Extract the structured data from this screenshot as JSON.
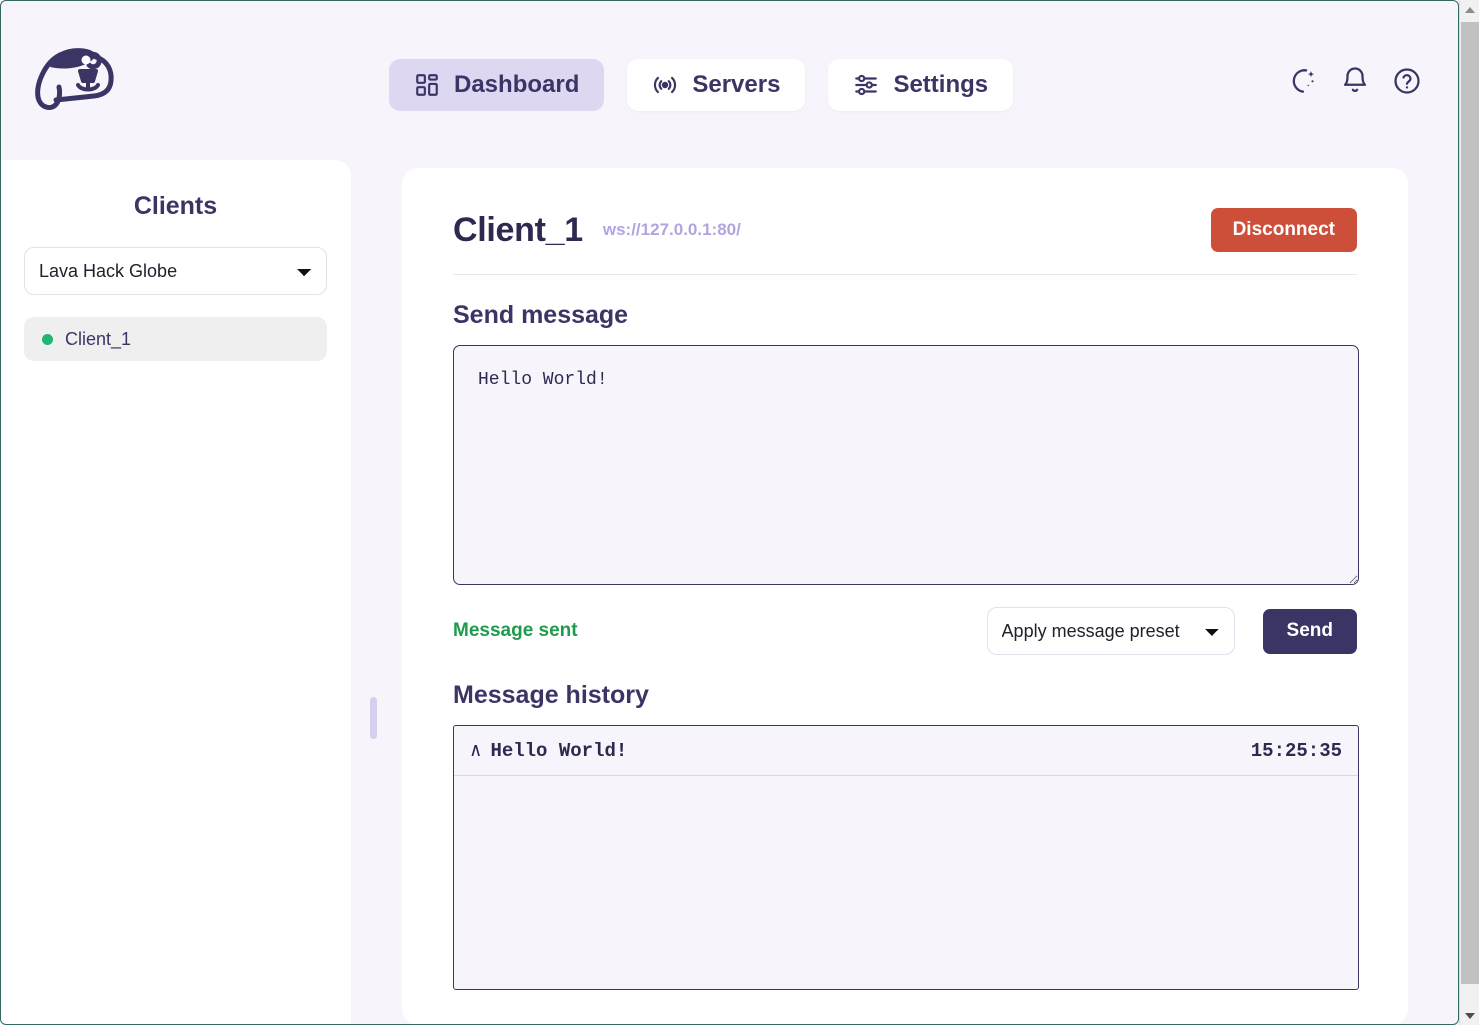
{
  "app": {
    "logo_name": "capybara-logo"
  },
  "nav": {
    "items": [
      {
        "label": "Dashboard",
        "icon": "layout-dashboard-icon",
        "active": true
      },
      {
        "label": "Servers",
        "icon": "broadcast-signal-icon",
        "active": false
      },
      {
        "label": "Settings",
        "icon": "sliders-icon",
        "active": false
      }
    ]
  },
  "header_actions": [
    {
      "name": "dark-mode-toggle",
      "icon": "moon-sparkle-icon"
    },
    {
      "name": "notifications-button",
      "icon": "bell-icon"
    },
    {
      "name": "help-button",
      "icon": "question-circle-icon"
    }
  ],
  "sidebar": {
    "title": "Clients",
    "server_select": {
      "value": "Lava Hack Globe",
      "options": [
        "Lava Hack Globe"
      ]
    },
    "clients": [
      {
        "name": "Client_1",
        "status": "connected",
        "status_color": "#21b573",
        "selected": true
      }
    ]
  },
  "main": {
    "client_title": "Client_1",
    "client_url": "ws://127.0.0.1:80/",
    "disconnect_label": "Disconnect",
    "send_section_title": "Send message",
    "message_value": "Hello World!",
    "message_placeholder": "",
    "status_text": "Message sent",
    "status_color": "#1f9b4e",
    "preset_select": {
      "value": "Apply message preset",
      "options": [
        "Apply message preset"
      ]
    },
    "send_label": "Send",
    "history_section_title": "Message history",
    "history": [
      {
        "direction_icon": "chevron-up-icon",
        "direction_glyph": "∧",
        "text": "Hello World!",
        "time": "15:25:35"
      }
    ]
  },
  "colors": {
    "page_bg": "#f7f5fb",
    "accent": "#3b3565",
    "accent_light": "#ded7f2",
    "danger": "#ce4f39",
    "success": "#1f9b4e",
    "url_text": "#b3a4e0"
  }
}
